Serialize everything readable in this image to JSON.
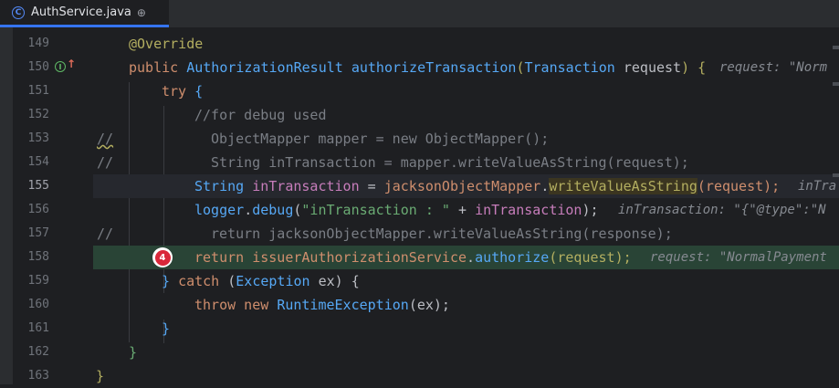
{
  "tab": {
    "title": "AuthService.java",
    "icon": "class-icon",
    "class_badge": "C",
    "pin_icon": "pin-icon",
    "pin_glyph": "⊕"
  },
  "gutter": {
    "override_badge": "I",
    "override_arrow": "↑",
    "breakpoint_label": "4"
  },
  "lines": {
    "l149": {
      "num": "149",
      "t1": "@Override"
    },
    "l150": {
      "num": "150",
      "t1": "public ",
      "t2": "AuthorizationResult ",
      "t3": "authorizeTransaction",
      "t4": "(",
      "t5": "Transaction ",
      "t6": "request",
      "t7": ") {",
      "hint": "request: \"Norm"
    },
    "l151": {
      "num": "151",
      "t1": "try",
      "t2": " {"
    },
    "l152": {
      "num": "152",
      "t1": "//for debug used"
    },
    "l153": {
      "num": "153",
      "mark": "//",
      "t1": "ObjectMapper mapper = new ObjectMapper();"
    },
    "l154": {
      "num": "154",
      "mark": "//",
      "t1": "String inTransaction = mapper.writeValueAsString(request);"
    },
    "l155": {
      "num": "155",
      "t1": "String ",
      "t2": "inTransaction",
      "t3": " = ",
      "t4": "jacksonObjectMapper",
      "t5": ".",
      "t6": "writeValueAsString",
      "t7": "(request);",
      "hint": "inTra"
    },
    "l156": {
      "num": "156",
      "t1": "logger",
      "t2": ".",
      "t3": "debug",
      "t4": "(",
      "t5": "\"inTransaction : \"",
      "t6": " + ",
      "t7": "inTransaction",
      "t8": ");",
      "hint": "inTransaction: \"{\"@type\":\"N"
    },
    "l157": {
      "num": "157",
      "mark": "//",
      "t1": "return jacksonObjectMapper.writeValueAsString(response);"
    },
    "l158": {
      "num": "158",
      "t1": "return ",
      "t2": "issuerAuthorizationService",
      "t3": ".",
      "t4": "authorize",
      "t5": "(request);",
      "hint": "request: \"NormalPayment"
    },
    "l159": {
      "num": "159",
      "t1": "} ",
      "t2": "catch",
      "t3": " (",
      "t4": "Exception",
      "t5": " ex) {"
    },
    "l160": {
      "num": "160",
      "t1": "throw new ",
      "t2": "RuntimeException",
      "t3": "(ex);"
    },
    "l161": {
      "num": "161",
      "t1": "}"
    },
    "l162": {
      "num": "162",
      "t1": "}"
    },
    "l163": {
      "num": "163",
      "t1": "}"
    }
  },
  "colors": {
    "background": "#1e1f22",
    "keyword": "#cf8e6d",
    "method": "#56a8f5",
    "string": "#6aab73",
    "current_line": "#26282e",
    "execution_line": "#294436",
    "breakpoint": "#d9283a"
  }
}
